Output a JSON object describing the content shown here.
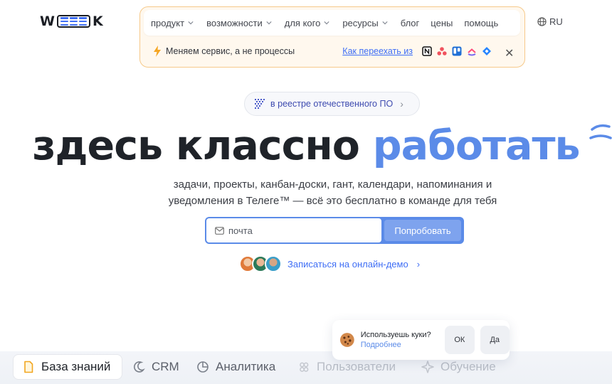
{
  "logo": {
    "left": "W",
    "right": "K"
  },
  "nav": {
    "items": [
      "продукт",
      "возможности",
      "для кого",
      "ресурсы"
    ],
    "plain_items": [
      "блог",
      "цены",
      "помощь"
    ]
  },
  "promo": {
    "text": "Меняем сервис, а не процессы",
    "link": "Как переехать из",
    "services": [
      "notion-icon",
      "asana-icon",
      "trello-icon",
      "clickup-icon",
      "jira-icon"
    ]
  },
  "lang": {
    "label": "RU"
  },
  "registry": {
    "label": "в реестре отечественного ПО",
    "arrow": "›"
  },
  "hero": {
    "title_part1": "здесь классно ",
    "title_part2": "работать",
    "subtitle_line1": "задачи, проекты, канбан-доски, гант, календари, напоминания и",
    "subtitle_line2": "уведомления в Телеге™ — всё это бесплатно в команде для тебя"
  },
  "form": {
    "email_placeholder": "почта",
    "button": "Попробовать"
  },
  "demo": {
    "label": "Записаться на онлайн-демо",
    "arrow": "›"
  },
  "tabs": [
    "База знаний",
    "CRM",
    "Аналитика",
    "Пользователи",
    "Обучение"
  ],
  "cookie": {
    "question": "Используешь куки?",
    "more": "Подробнее",
    "ok": "ОК",
    "yes": "Да"
  },
  "colors": {
    "accent": "#5b8be8",
    "link": "#3f6ef5",
    "promo_border": "#f6c98a"
  }
}
